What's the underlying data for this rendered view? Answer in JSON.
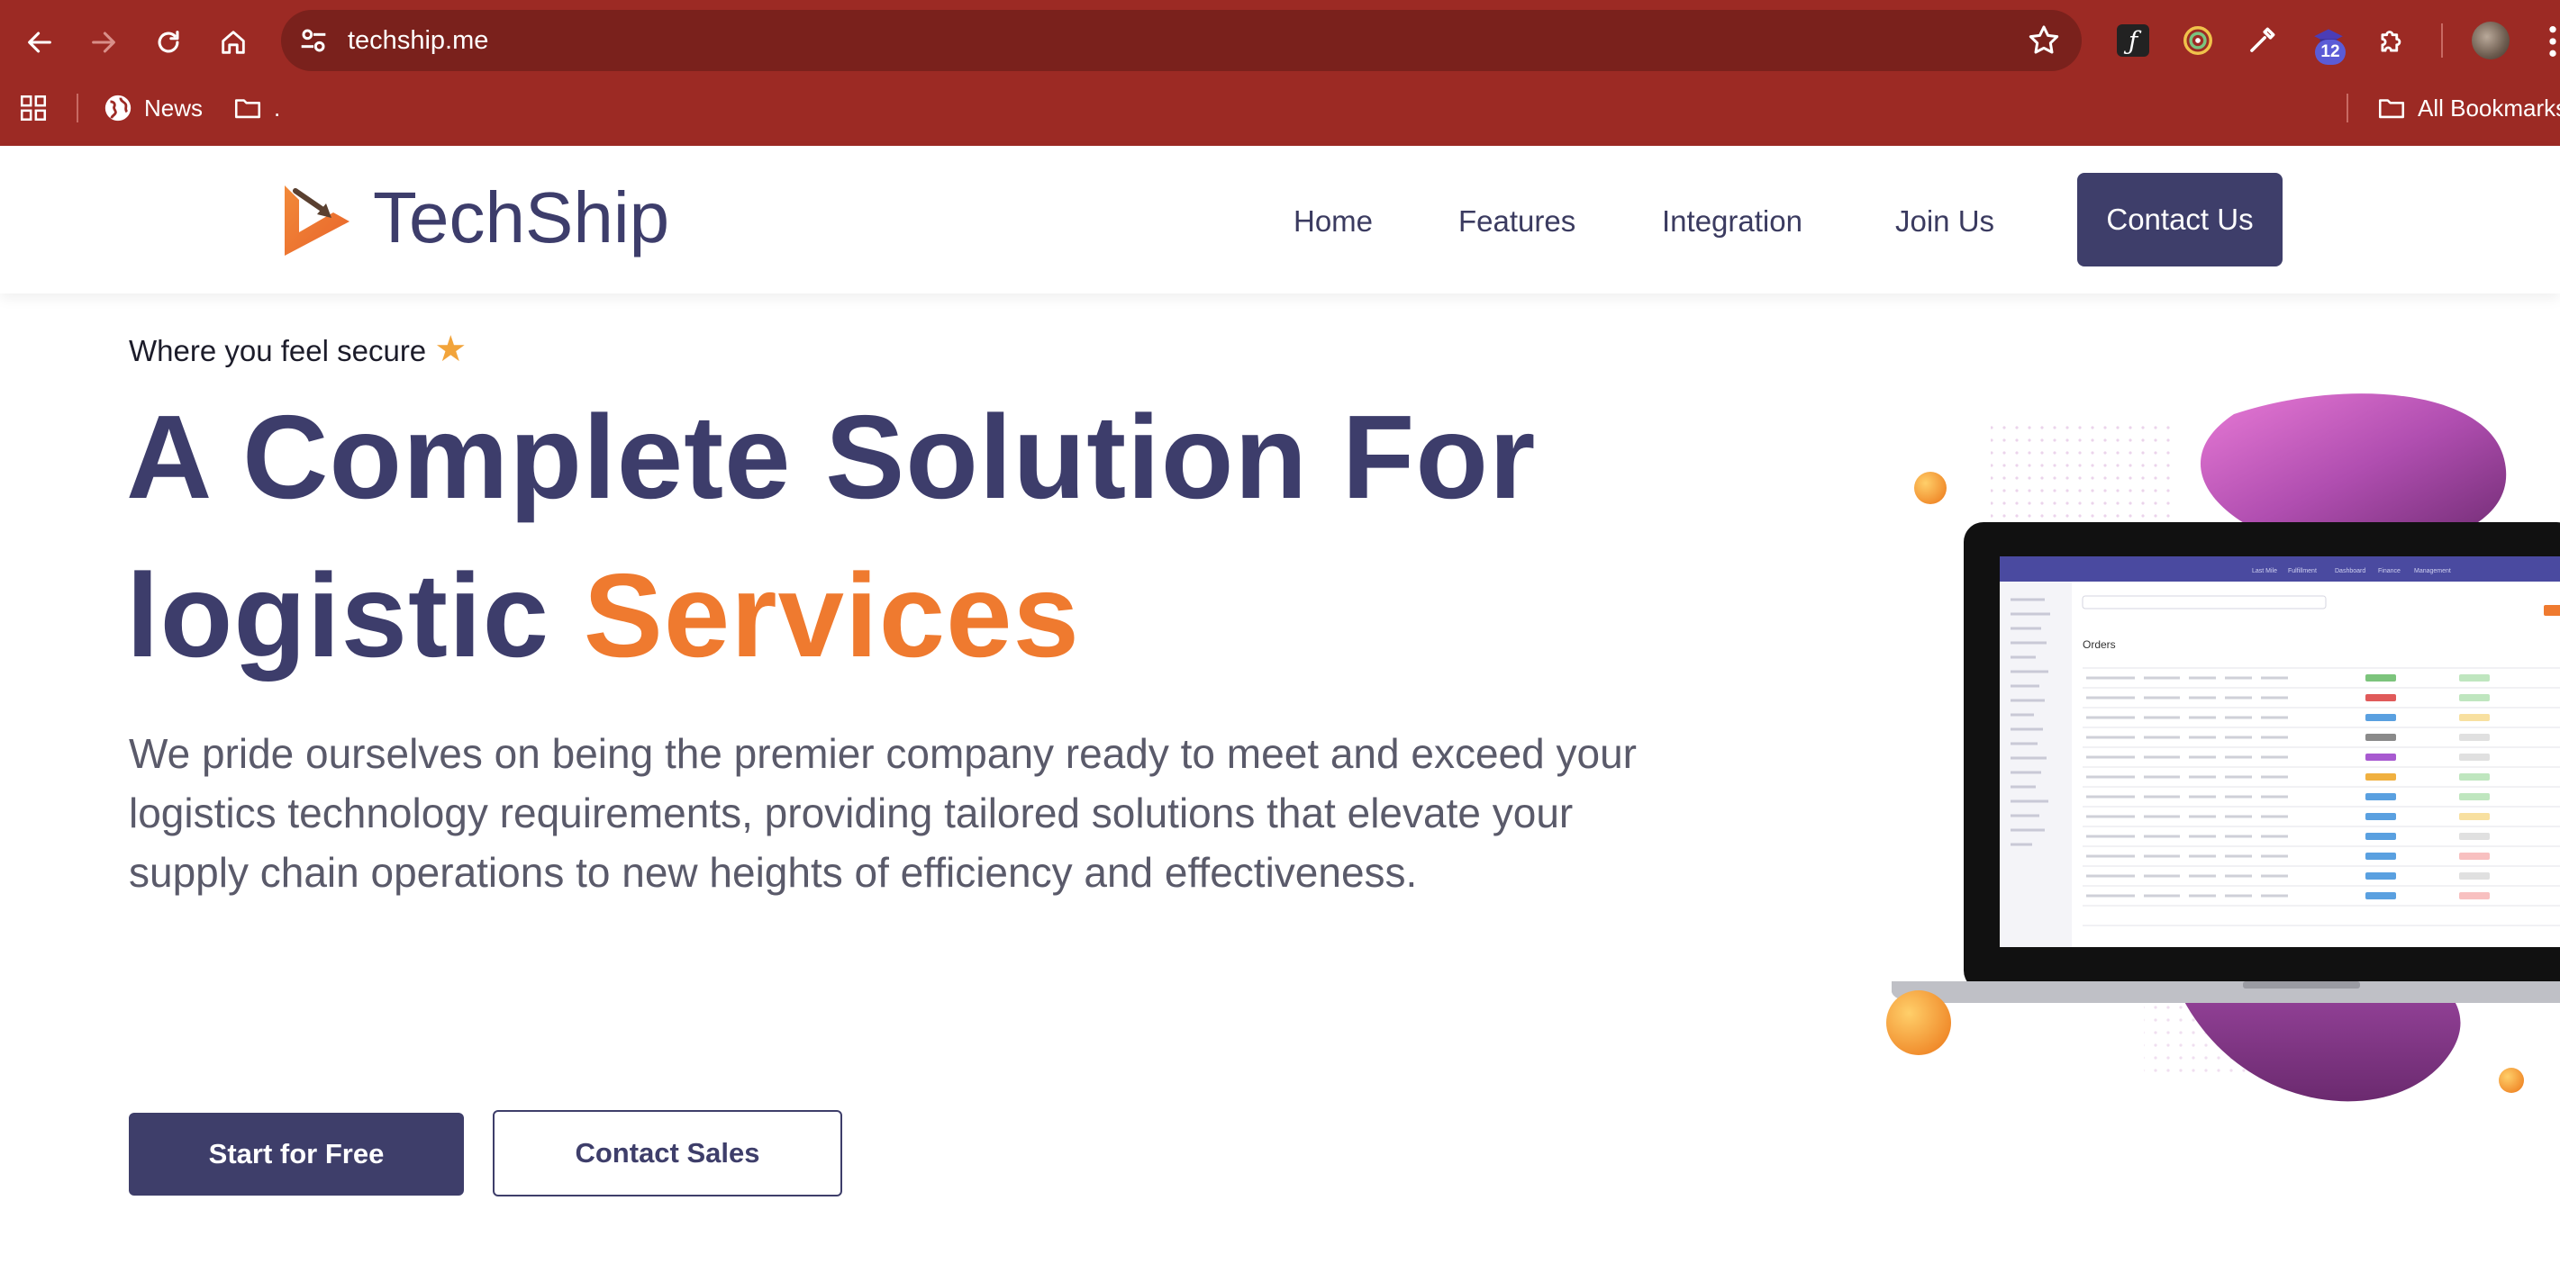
{
  "browser": {
    "url": "techship.me",
    "extension_badge": "12",
    "bookmarks": [
      {
        "label": "News",
        "icon": "globe-icon"
      },
      {
        "label": ".",
        "icon": "folder-icon"
      }
    ],
    "all_bookmarks_label": "All Bookmarks",
    "theme_color": "#9c2a24"
  },
  "header": {
    "brand": "TechShip",
    "nav": [
      "Home",
      "Features",
      "Integration",
      "Join Us"
    ],
    "cta": "Contact Us"
  },
  "hero": {
    "tagline": "Where you feel secure",
    "tagline_icon": "star-icon",
    "title_line1": "A Complete Solution For",
    "title_line2_plain": "logistic",
    "title_line2_accent": "Services",
    "description": "We pride ourselves on being the premier company ready to meet and exceed your logistics technology requirements, providing tailored solutions that elevate your supply chain operations to new heights of efficiency and effectiveness.",
    "primary_button": "Start for Free",
    "secondary_button": "Contact Sales"
  },
  "colors": {
    "brand_navy": "#3e3e6a",
    "accent_orange": "#ef7a2f",
    "blob_purple": "#9b3f9c"
  },
  "illustration": {
    "screen_nav": [
      "Last Mile",
      "Fulfillment",
      "Dashboard",
      "Finance",
      "Management"
    ],
    "screen_heading": "Orders"
  }
}
